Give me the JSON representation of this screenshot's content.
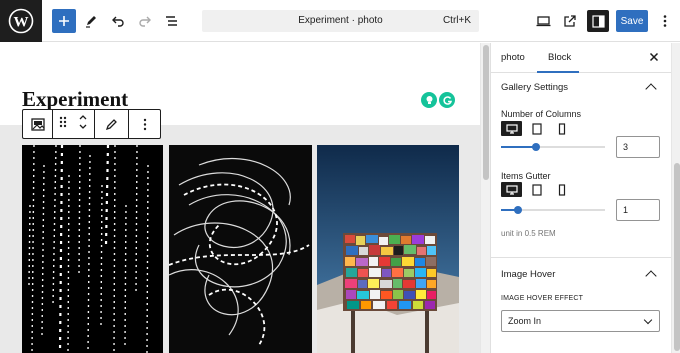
{
  "topbar": {
    "doc_title": "Experiment · photo",
    "shortcut": "Ctrl+K",
    "save_label": "Save"
  },
  "editor": {
    "post_title": "Experiment"
  },
  "panel": {
    "tabs": [
      {
        "label": "photo"
      },
      {
        "label": "Block"
      }
    ],
    "gallery_settings": {
      "heading": "Gallery Settings",
      "columns_label": "Number of Columns",
      "columns_value": "3",
      "gutter_label": "Items Gutter",
      "gutter_value": "1",
      "unit_hint": "unit in 0.5 REM"
    },
    "image_hover": {
      "heading": "Image Hover",
      "effect_label": "IMAGE HOVER EFFECT",
      "effect_value": "Zoom In"
    }
  },
  "colors": {
    "accent": "#2f6fbf",
    "dark": "#1e1e1e"
  }
}
